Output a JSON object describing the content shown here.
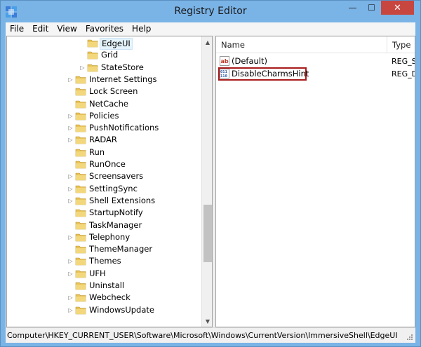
{
  "window": {
    "title": "Registry Editor",
    "minimize": "—",
    "maximize": "☐",
    "close": "✕"
  },
  "menu": [
    "File",
    "Edit",
    "View",
    "Favorites",
    "Help"
  ],
  "tree": {
    "items": [
      {
        "label": "EdgeUI",
        "level": 2,
        "expander": "",
        "selected": true
      },
      {
        "label": "Grid",
        "level": 2,
        "expander": ""
      },
      {
        "label": "StateStore",
        "level": 2,
        "expander": "▷"
      },
      {
        "label": "Internet Settings",
        "level": 1,
        "expander": "▷"
      },
      {
        "label": "Lock Screen",
        "level": 1,
        "expander": ""
      },
      {
        "label": "NetCache",
        "level": 1,
        "expander": ""
      },
      {
        "label": "Policies",
        "level": 1,
        "expander": "▷"
      },
      {
        "label": "PushNotifications",
        "level": 1,
        "expander": "▷"
      },
      {
        "label": "RADAR",
        "level": 1,
        "expander": "▷"
      },
      {
        "label": "Run",
        "level": 1,
        "expander": ""
      },
      {
        "label": "RunOnce",
        "level": 1,
        "expander": ""
      },
      {
        "label": "Screensavers",
        "level": 1,
        "expander": "▷"
      },
      {
        "label": "SettingSync",
        "level": 1,
        "expander": "▷"
      },
      {
        "label": "Shell Extensions",
        "level": 1,
        "expander": "▷"
      },
      {
        "label": "StartupNotify",
        "level": 1,
        "expander": ""
      },
      {
        "label": "TaskManager",
        "level": 1,
        "expander": ""
      },
      {
        "label": "Telephony",
        "level": 1,
        "expander": "▷"
      },
      {
        "label": "ThemeManager",
        "level": 1,
        "expander": ""
      },
      {
        "label": "Themes",
        "level": 1,
        "expander": "▷"
      },
      {
        "label": "UFH",
        "level": 1,
        "expander": "▷"
      },
      {
        "label": "Uninstall",
        "level": 1,
        "expander": ""
      },
      {
        "label": "Webcheck",
        "level": 1,
        "expander": "▷"
      },
      {
        "label": "WindowsUpdate",
        "level": 1,
        "expander": "▷"
      }
    ],
    "scroll_up": "▲",
    "scroll_down": "▼"
  },
  "list": {
    "columns": {
      "name": "Name",
      "type": "Type"
    },
    "rows": [
      {
        "name": "(Default)",
        "type": "REG_SZ",
        "icon": "string-value-icon"
      },
      {
        "name": "DisableCharmsHint",
        "type": "REG_DW",
        "icon": "dword-value-icon",
        "highlight": true
      }
    ]
  },
  "status": {
    "path": "Computer\\HKEY_CURRENT_USER\\Software\\Microsoft\\Windows\\CurrentVersion\\ImmersiveShell\\EdgeUI"
  },
  "colors": {
    "title_bg": "#7ab3e6",
    "close_red": "#c7463f",
    "folder": "#e8c35a",
    "highlight_box": "#a81b1b"
  }
}
